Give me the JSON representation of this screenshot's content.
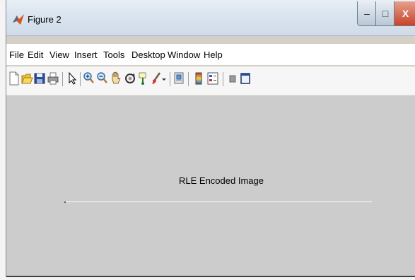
{
  "window": {
    "title": "Figure 2"
  },
  "controls": {
    "minimize": "–",
    "maximize": "□",
    "close": "X"
  },
  "menu": {
    "items": [
      "File",
      "Edit",
      "View",
      "Insert",
      "Tools",
      "Desktop",
      "Window",
      "Help"
    ]
  },
  "toolbar": {
    "icons": [
      "new-figure-icon",
      "open-file-icon",
      "save-icon",
      "print-icon",
      "edit-plot-arrow-icon",
      "zoom-in-icon",
      "zoom-out-icon",
      "pan-hand-icon",
      "rotate-3d-icon",
      "data-cursor-icon",
      "brush-icon",
      "brush-dropdown-icon",
      "link-plot-icon",
      "colorbar-icon",
      "legend-icon",
      "hide-plot-tools-icon",
      "show-plot-tools-icon"
    ]
  },
  "axes": {
    "title": "RLE Encoded Image"
  },
  "colors": {
    "canvas": "#cccccc",
    "close_button": "#c8432a"
  }
}
